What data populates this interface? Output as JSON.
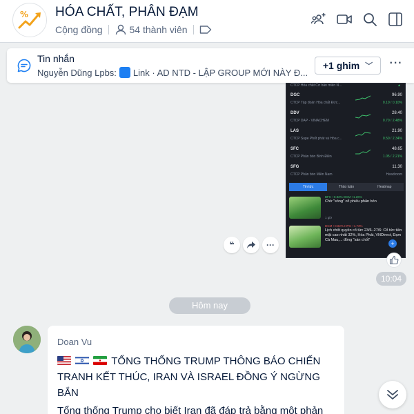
{
  "header": {
    "group_name": "HÓA CHẤT, PHÂN ĐẠM",
    "community_label": "Cộng đồng",
    "member_count": "54 thành viên"
  },
  "pinned": {
    "title": "Tin nhắn",
    "sender": "Nguyễn Dũng Lpbs:",
    "preview": "Link · AD NTD - LẬP GROUP MỚI NÀY Đ...",
    "pin_button": "+1 ghim",
    "more": "···"
  },
  "stock_image": {
    "top_line": "CTCP Hóa chất Cơ bản miền N...",
    "rows": [
      {
        "code": "DGC",
        "name": "CTCP Tập đoàn Hóa chất Đức...",
        "price": "96.90",
        "change": "0.10 / 0.10%"
      },
      {
        "code": "DDV",
        "name": "CTCP DAP - VINACHEM",
        "price": "28.40",
        "change": "0.70 / 2.48%"
      },
      {
        "code": "LAS",
        "name": "CTCP Supe Phốt phát và Hóa c...",
        "price": "21.90",
        "change": "0.50 / 2.34%"
      },
      {
        "code": "SFC",
        "name": "CTCP Phân bón Bình Điền",
        "price": "48.65",
        "change": "1.05 / 2.21%"
      },
      {
        "code": "SFG",
        "name": "CTCP Phân bón Miền Nam",
        "price": "11.30",
        "change": "Headroom"
      }
    ],
    "tabs": [
      "Tin tức",
      "Thảo luận",
      "Heatmap"
    ],
    "news": [
      {
        "meta": "BFC +0.82%   DCM +1.26%",
        "title": "Chờ \"sóng\" cổ phiếu phân bón",
        "foot": "1 giờ"
      },
      {
        "meta": "DCM +0.82%   HPG +1.73%",
        "title": "Lịch chốt quyền cổ tức 23/6–27/6: Cổ tức tiền mặt cao nhất 32%, Hòa Phát, VNDirect, Đạm Cà Mau,... đồng \"sàn chốt\"",
        "foot": ""
      }
    ]
  },
  "message_actions": {
    "quote": "❝",
    "share": "➦",
    "more": "···"
  },
  "time": "10:04",
  "date_separator": "Hôm nay",
  "message": {
    "sender": "Doan Vu",
    "flags": [
      "us-flag",
      "israel-flag",
      "iran-flag"
    ],
    "headline": "TỔNG THỐNG TRUMP THÔNG BÁO CHIẾN TRANH KẾT THÚC, IRAN VÀ ISRAEL ĐỒNG Ý NGỪNG BẮN",
    "body": "Tổng thống Trump cho biết Iran đã đáp trả bằng một phản"
  },
  "colors": {
    "accent": "#1d7ff2",
    "background": "#eef0f1",
    "up_green": "#3ec46d"
  }
}
